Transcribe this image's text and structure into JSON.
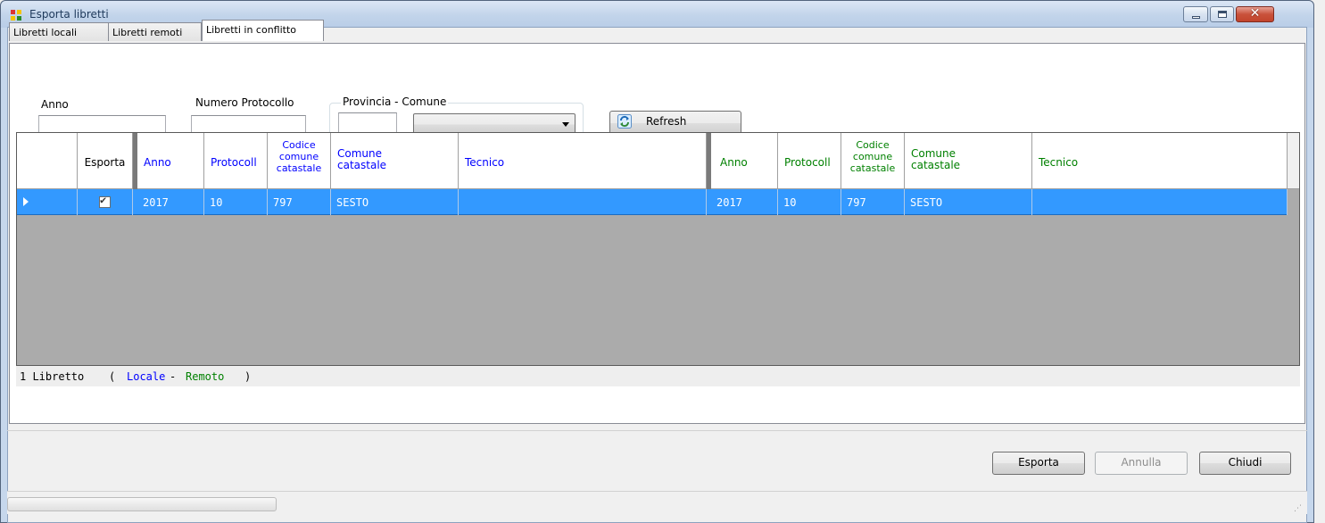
{
  "window": {
    "title": "Esporta libretti",
    "buttons": {
      "minimize": "minimize",
      "maximize": "maximize",
      "close": "✕"
    }
  },
  "tabs": [
    {
      "label": "Libretti locali"
    },
    {
      "label": "Libretti remoti"
    },
    {
      "label": "Libretti in conflitto"
    }
  ],
  "filters": {
    "anno_label": "Anno",
    "anno_value": "",
    "protocollo_label": "Numero Protocollo",
    "protocollo_value": "",
    "provincia_comune_label": "Provincia - Comune",
    "provincia_value": "",
    "comune_value": "",
    "refresh_label": "Refresh"
  },
  "grid": {
    "left_headers": {
      "esporta": "Esporta",
      "anno": "Anno",
      "protocollo": "Protocoll",
      "codice_1": "Codice",
      "codice_2": "comune",
      "codice_3": "catastale",
      "comune_1": "Comune",
      "comune_2": "catastale",
      "tecnico": "Tecnico"
    },
    "right_headers": {
      "anno": "Anno",
      "protocollo": "Protocoll",
      "codice_1": "Codice",
      "codice_2": "comune",
      "codice_3": "catastale",
      "comune_1": "Comune",
      "comune_2": "catastale",
      "tecnico": "Tecnico"
    },
    "rows": [
      {
        "esporta": true,
        "local": {
          "anno": "2017",
          "protocollo": "10",
          "codice": "797",
          "comune": "SESTO",
          "tecnico": ""
        },
        "remote": {
          "anno": "2017",
          "protocollo": "10",
          "codice": "797",
          "comune": "SESTO",
          "tecnico": ""
        }
      }
    ],
    "colors": {
      "local_header": "#0000ff",
      "remote_header": "#008000",
      "selection": "#3399ff",
      "empty_area": "#ababab"
    }
  },
  "summary": {
    "count_text": "1 Libretto",
    "open_paren": "(",
    "locale": "Locale",
    "dash": "-",
    "remoto": "Remoto",
    "close_paren": ")"
  },
  "actions": {
    "esporta": "Esporta",
    "annulla": "Annulla",
    "chiudi": "Chiudi"
  },
  "status": {
    "progress": 0
  }
}
